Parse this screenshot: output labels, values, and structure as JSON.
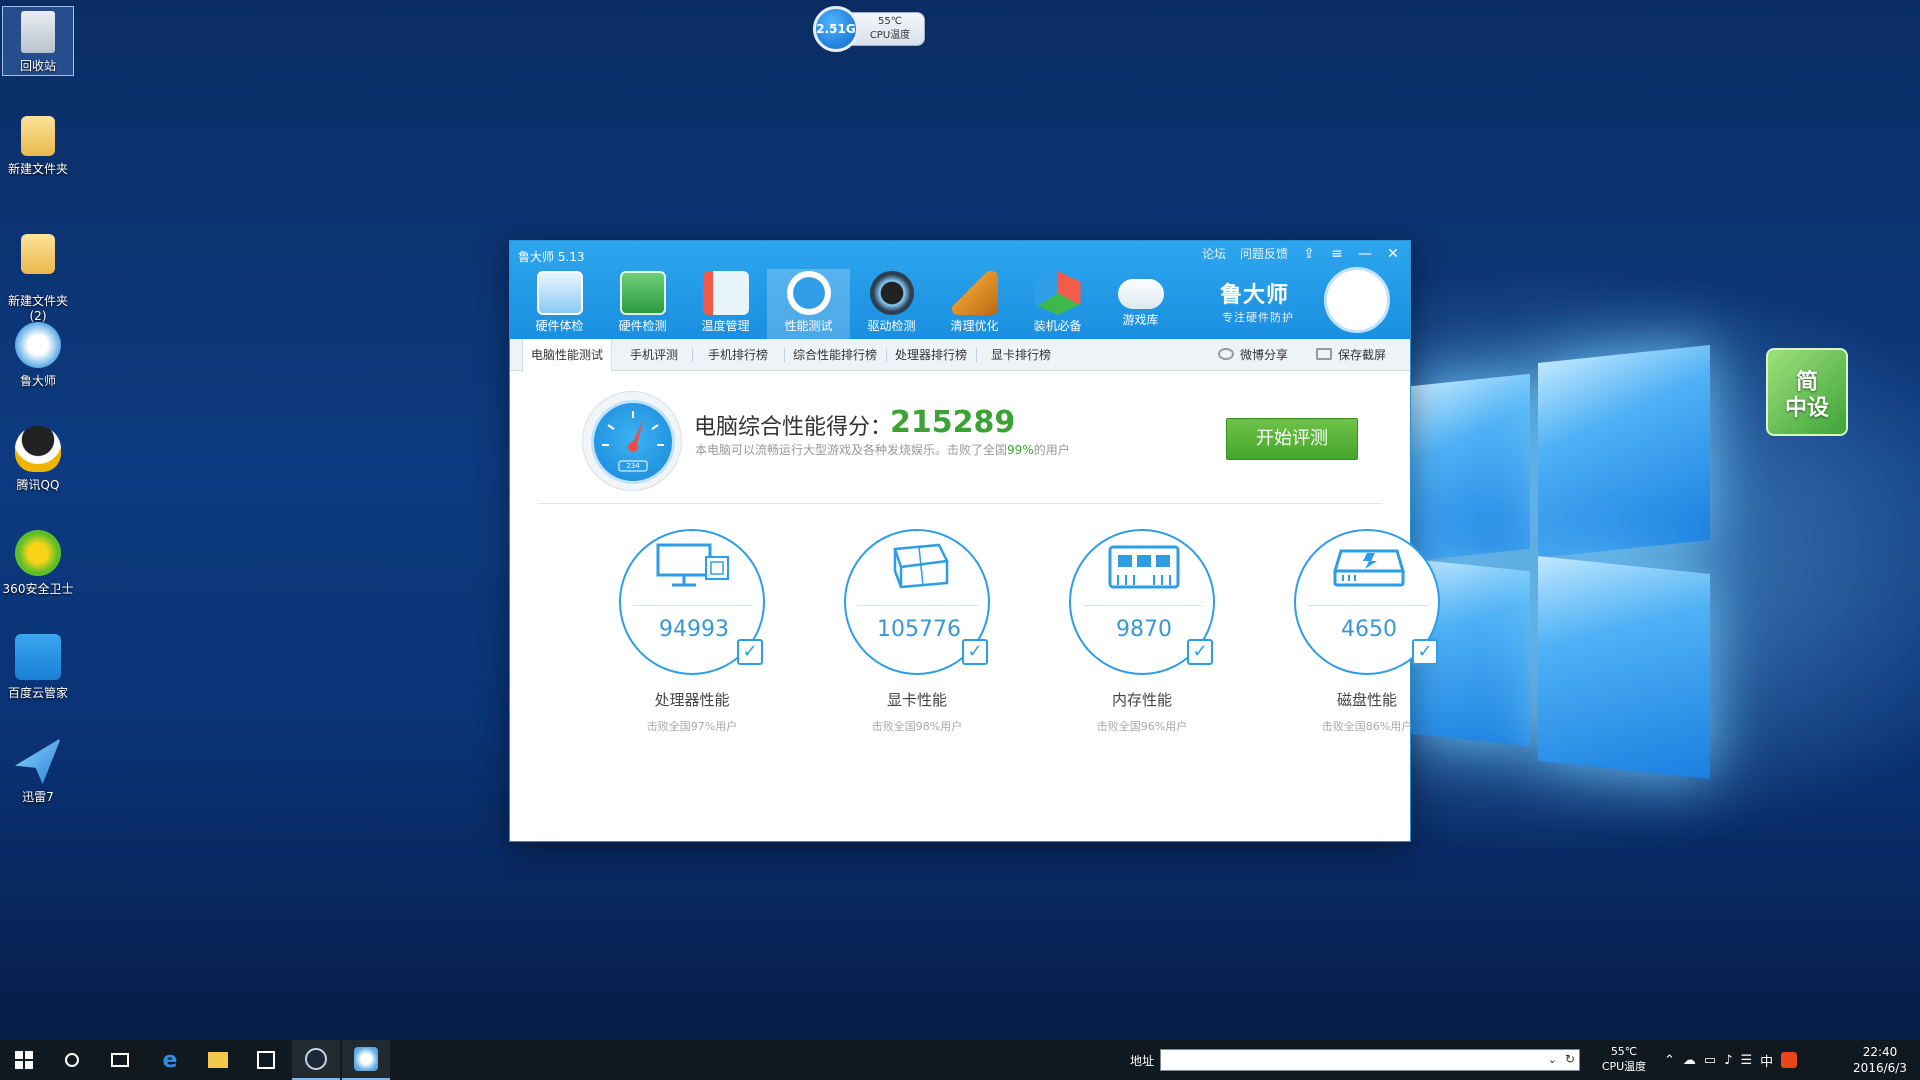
{
  "desktop": {
    "icons": [
      {
        "label": "回收站",
        "icon": "recycle-bin-icon"
      },
      {
        "label": "新建文件夹",
        "icon": "folder-icon"
      },
      {
        "label": "新建文件夹\n(2)",
        "icon": "folder-icon"
      },
      {
        "label": "鲁大师",
        "icon": "ludashi-icon"
      },
      {
        "label": "腾讯QQ",
        "icon": "qq-icon"
      },
      {
        "label": "360安全卫士",
        "icon": "360-security-icon"
      },
      {
        "label": "百度云管家",
        "icon": "baidu-cloud-icon"
      },
      {
        "label": "迅雷7",
        "icon": "thunder-icon"
      }
    ],
    "cpu_widget": {
      "freq": "2.51G",
      "temp": "55℃",
      "temp_label": "CPU温度"
    },
    "gadget": {
      "line1": "简",
      "line2": "中设"
    }
  },
  "app": {
    "title": "鲁大师 5.13",
    "title_links": [
      "论坛",
      "问题反馈"
    ],
    "controls": {
      "skin": "⇪",
      "menu": "≡",
      "minimize": "—",
      "close": "✕"
    },
    "tools": [
      {
        "label": "硬件体检",
        "icon": "monitor-drop-icon"
      },
      {
        "label": "硬件检测",
        "icon": "circuit-board-icon"
      },
      {
        "label": "温度管理",
        "icon": "thermometer-icon"
      },
      {
        "label": "性能测试",
        "icon": "speedometer-icon",
        "active": true
      },
      {
        "label": "驱动检测",
        "icon": "driver-gear-icon"
      },
      {
        "label": "清理优化",
        "icon": "broom-icon"
      },
      {
        "label": "装机必备",
        "icon": "cube-icon"
      },
      {
        "label": "游戏库",
        "icon": "gamepad-icon"
      }
    ],
    "brand": {
      "name": "鲁大师",
      "slogan": "专注硬件防护"
    },
    "subtabs": [
      "电脑性能测试",
      "手机评测",
      "手机排行榜",
      "综合性能排行榜",
      "处理器排行榜",
      "显卡排行榜"
    ],
    "share": {
      "weibo": "微博分享",
      "screenshot": "保存截屏"
    },
    "score": {
      "label": "电脑综合性能得分：",
      "value": "215289",
      "desc_pre": "本电脑可以流畅运行大型游戏及各种发烧娱乐。击败了全国",
      "desc_pct": "99%",
      "desc_post": "的用户",
      "gauge_value": "234",
      "start_button": "开始评测"
    },
    "metrics": [
      {
        "name": "处理器性能",
        "value": "94993",
        "sub": "击败全国97%用户",
        "icon": "cpu-monitor-icon"
      },
      {
        "name": "显卡性能",
        "value": "105776",
        "sub": "击败全国98%用户",
        "icon": "graphics-cube-icon"
      },
      {
        "name": "内存性能",
        "value": "9870",
        "sub": "击败全国96%用户",
        "icon": "memory-chip-icon"
      },
      {
        "name": "磁盘性能",
        "value": "4650",
        "sub": "击败全国86%用户",
        "icon": "hard-disk-icon"
      }
    ]
  },
  "taskbar": {
    "address_label": "地址",
    "temp": "55℃",
    "temp_label": "CPU温度",
    "ime": "中",
    "time": "22:40",
    "date": "2016/6/3"
  },
  "colors": {
    "accent": "#1a8fe0",
    "score_green": "#3aa334",
    "ring_blue": "#2d9de6"
  }
}
